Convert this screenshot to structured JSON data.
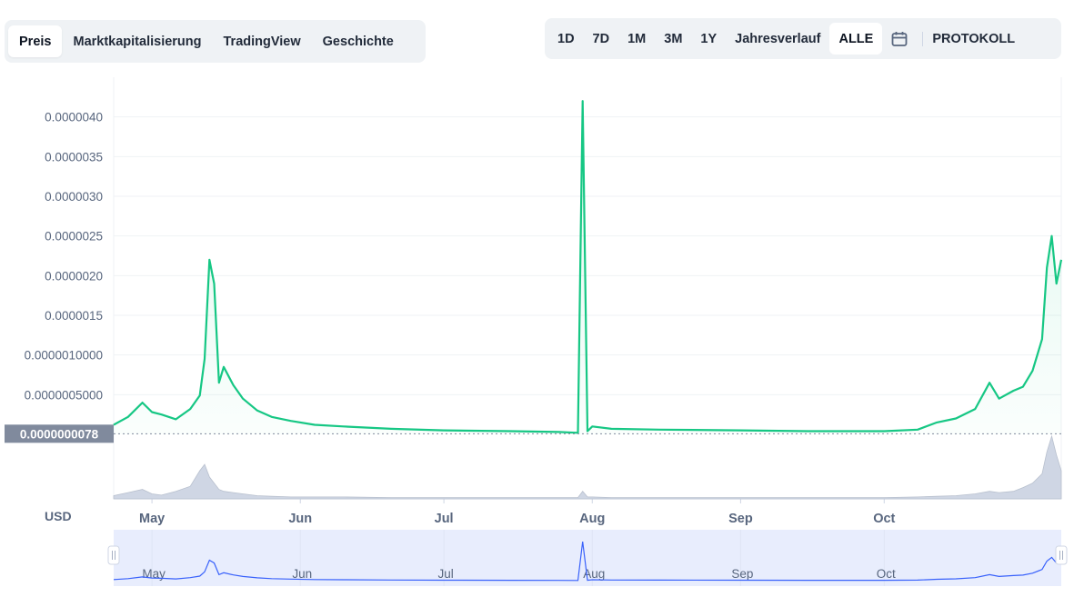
{
  "tabs": {
    "items": [
      {
        "label": "Preis",
        "active": true
      },
      {
        "label": "Marktkapitalisierung",
        "active": false
      },
      {
        "label": "TradingView",
        "active": false
      },
      {
        "label": "Geschichte",
        "active": false
      }
    ]
  },
  "ranges": {
    "items": [
      {
        "label": "1D",
        "active": false
      },
      {
        "label": "7D",
        "active": false
      },
      {
        "label": "1M",
        "active": false
      },
      {
        "label": "3M",
        "active": false
      },
      {
        "label": "1Y",
        "active": false
      },
      {
        "label": "Jahresverlauf",
        "active": false
      },
      {
        "label": "ALLE",
        "active": true
      }
    ],
    "calendar_icon": "calendar-icon",
    "log_label": "PROTOKOLL"
  },
  "currency_label": "USD",
  "colors": {
    "line": "#16c784",
    "volume": "#cfd6e4",
    "navigator_line": "#3861fb",
    "navigator_bg": "#e8edfd",
    "price_tag_bg": "#808a9d"
  },
  "chart_data": {
    "type": "area",
    "ylim": [
      0,
      4.5e-06
    ],
    "yticks": [
      "0.0000005000",
      "0.0000010000",
      "0.0000015",
      "0.0000020",
      "0.0000025",
      "0.0000030",
      "0.0000035",
      "0.0000040"
    ],
    "ytick_values": [
      5e-07,
      1e-06,
      1.5e-06,
      2e-06,
      2.5e-06,
      3e-06,
      3.5e-06,
      4e-06
    ],
    "current_price_label": "0.0000000078",
    "current_price": 7.8e-09,
    "xticks": [
      "May",
      "Jun",
      "Jul",
      "Aug",
      "Sep",
      "Oct"
    ],
    "x": [
      "04-23",
      "04-26",
      "04-29",
      "05-01",
      "05-03",
      "05-06",
      "05-09",
      "05-11",
      "05-12",
      "05-13",
      "05-14",
      "05-15",
      "05-16",
      "05-18",
      "05-20",
      "05-23",
      "05-26",
      "05-30",
      "06-04",
      "06-10",
      "06-20",
      "07-01",
      "07-15",
      "07-25",
      "07-29",
      "07-30",
      "07-31",
      "08-01",
      "08-05",
      "08-15",
      "09-01",
      "09-15",
      "10-01",
      "10-08",
      "10-12",
      "10-16",
      "10-20",
      "10-23",
      "10-25",
      "10-28",
      "10-30",
      "11-01",
      "11-03",
      "11-04",
      "11-05",
      "11-06",
      "11-07"
    ],
    "series": [
      {
        "values": [
          1.2e-07,
          2.2e-07,
          4e-07,
          2.8e-07,
          2.5e-07,
          1.9e-07,
          3.2e-07,
          4.9e-07,
          9.5e-07,
          2.2e-06,
          1.9e-06,
          6.5e-07,
          8.5e-07,
          6.2e-07,
          4.5e-07,
          3e-07,
          2.2e-07,
          1.7e-07,
          1.2e-07,
          1e-07,
          7e-08,
          5e-08,
          4e-08,
          3e-08,
          2e-08,
          4.2e-06,
          4e-08,
          1e-07,
          7e-08,
          6e-08,
          5e-08,
          4e-08,
          4e-08,
          6e-08,
          1.5e-07,
          2e-07,
          3.2e-07,
          6.5e-07,
          4.5e-07,
          5.5e-07,
          6e-07,
          8e-07,
          1.2e-06,
          2.1e-06,
          2.5e-06,
          1.9e-06,
          2.2e-06
        ]
      }
    ],
    "volume": [
      0.05,
      0.1,
      0.15,
      0.08,
      0.06,
      0.12,
      0.2,
      0.45,
      0.55,
      0.35,
      0.25,
      0.15,
      0.12,
      0.1,
      0.08,
      0.05,
      0.04,
      0.03,
      0.03,
      0.03,
      0.02,
      0.02,
      0.02,
      0.02,
      0.02,
      0.12,
      0.03,
      0.03,
      0.02,
      0.02,
      0.02,
      0.02,
      0.02,
      0.03,
      0.04,
      0.05,
      0.08,
      0.12,
      0.1,
      0.12,
      0.18,
      0.25,
      0.4,
      0.75,
      1.0,
      0.7,
      0.45
    ]
  }
}
